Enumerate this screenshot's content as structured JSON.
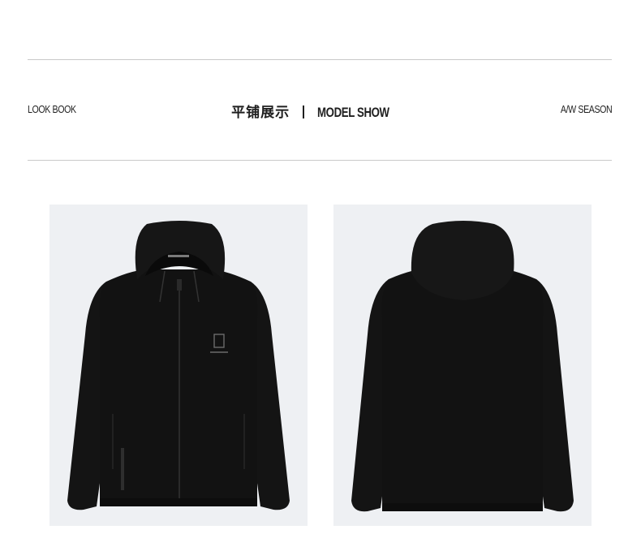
{
  "header": {
    "left_label": "LOOK BOOK",
    "title_cn": "平铺展示",
    "title_en": "MODEL SHOW",
    "right_label": "A/W SEASON"
  },
  "images": [
    {
      "name": "jacket-front",
      "view": "front"
    },
    {
      "name": "jacket-back",
      "view": "back"
    }
  ],
  "colors": {
    "background": "#ffffff",
    "panel": "#eef0f3",
    "jacket": "#111111",
    "rule": "#c9c9c9",
    "text": "#1f1f1f"
  }
}
